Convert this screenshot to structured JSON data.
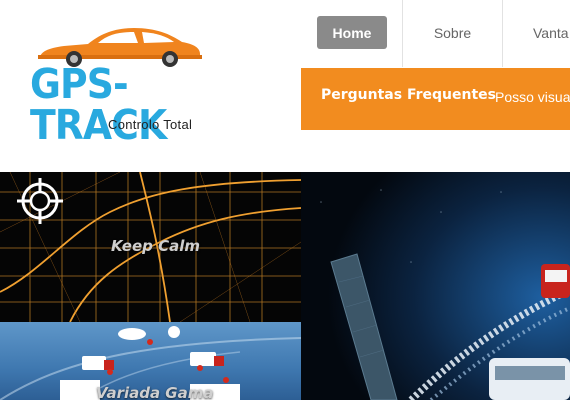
{
  "logo": {
    "title": "GPS-TRACK",
    "tagline": "Controlo Total",
    "car_icon": "sports-car-icon"
  },
  "nav": {
    "items": [
      {
        "label": "Home",
        "active": true
      },
      {
        "label": "Sobre",
        "active": false
      },
      {
        "label": "Vanta",
        "active": false
      }
    ]
  },
  "faq_bar": {
    "title": "Perguntas Frequentes",
    "question": "Posso visua"
  },
  "tiles": {
    "keep_calm": {
      "label": "Keep Calm",
      "icon": "crosshair-target-icon"
    },
    "variada_gama": {
      "label": "Variada Gama"
    },
    "hero": {
      "icon": "satellite-truck-illustration"
    }
  },
  "colors": {
    "accent_orange": "#f28c1f",
    "logo_blue": "#29a9df",
    "nav_active_bg": "#8a8a8a",
    "map_orange": "#e89a2c"
  }
}
